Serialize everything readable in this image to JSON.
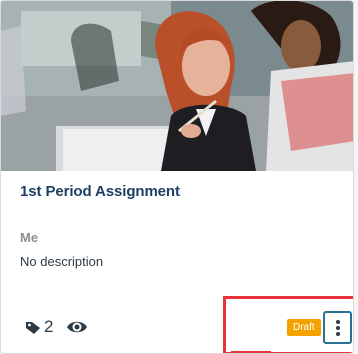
{
  "card": {
    "title": "1st Period Assignment",
    "author": "Me",
    "description": "No description",
    "tag_count": "2",
    "status_badge": "Draft",
    "thumbnail_alt": "Two women looking at a laptop",
    "colors": {
      "title": "#1d3f63",
      "author": "#8a8f93",
      "badge": "#f3a200",
      "highlight": "#e8323a",
      "focus_ring": "#2a6f94"
    },
    "icons": {
      "tags": "tag-icon",
      "views": "eye-icon",
      "menu": "kebab-menu-icon"
    }
  }
}
